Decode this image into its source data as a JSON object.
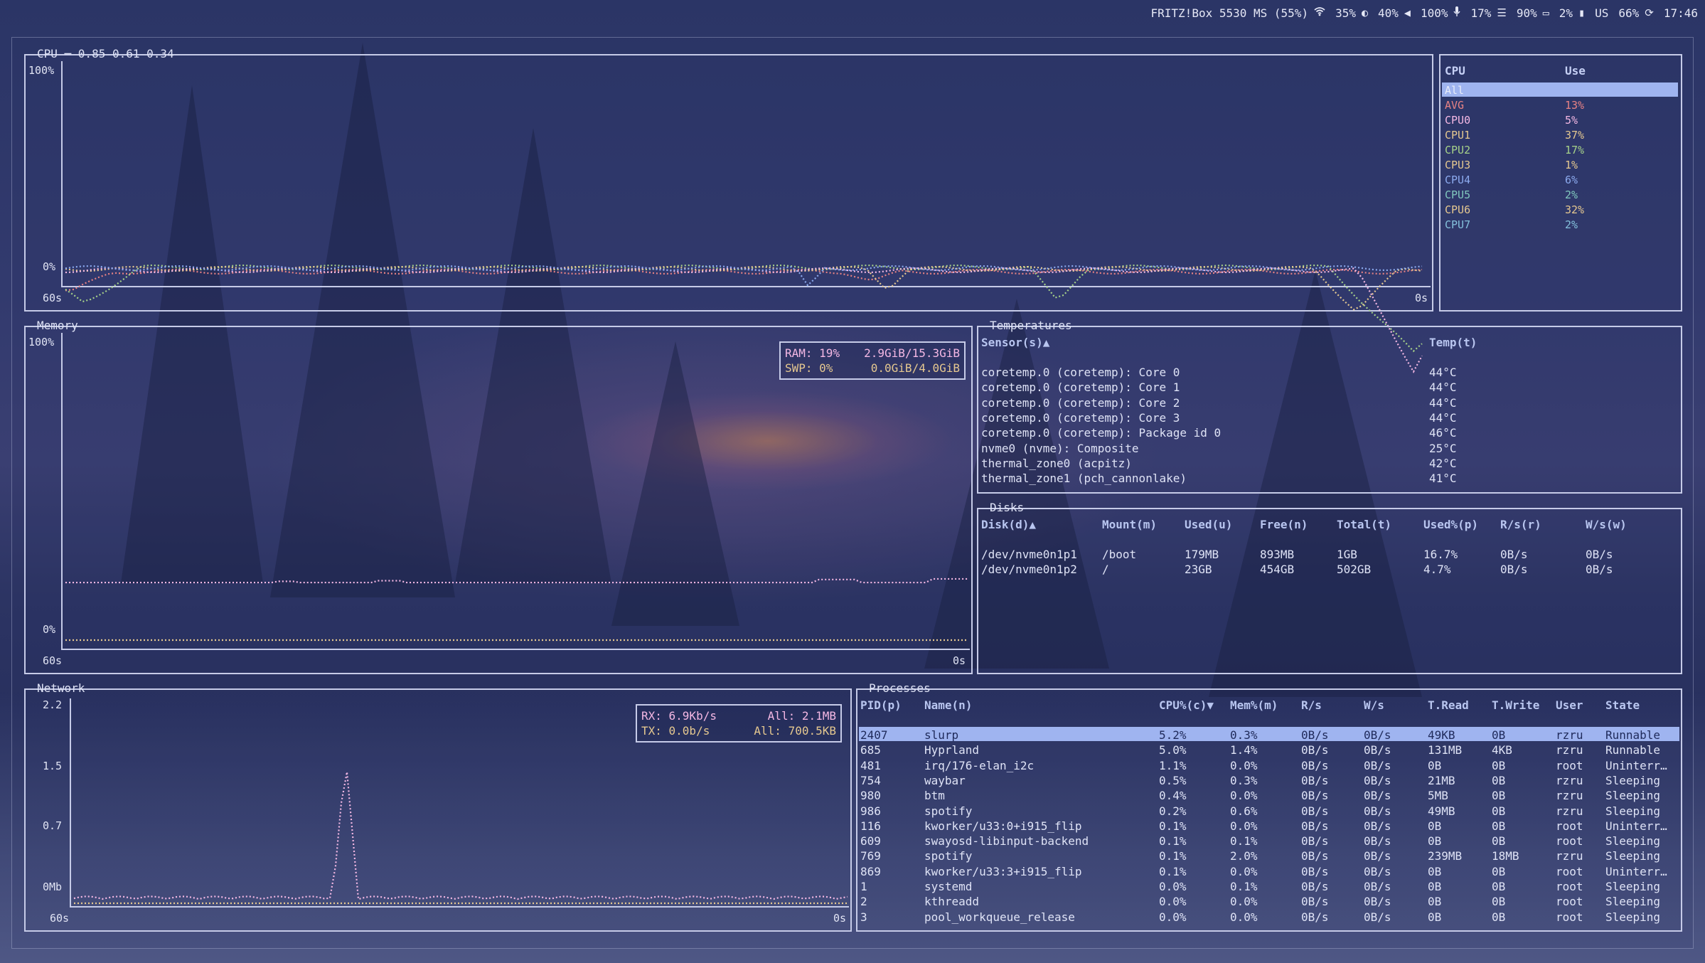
{
  "topbar": {
    "wifi": {
      "label": "FRITZ!Box 5530 MS (55%)",
      "icon": "wifi-icon"
    },
    "brightness": {
      "value": "35%",
      "icon": "brightness-icon"
    },
    "volume": {
      "value": "40%",
      "icon": "volume-icon"
    },
    "mic": {
      "value": "100%",
      "icon": "microphone-icon"
    },
    "cpu": {
      "value": "17%",
      "icon": "cpu-icon"
    },
    "memory": {
      "value": "90%",
      "icon": "memory-icon"
    },
    "disk": {
      "value": "2%",
      "icon": "disk-icon"
    },
    "layout": {
      "value": "US",
      "icon": "battery-icon"
    },
    "battery": {
      "value": "66%",
      "icon": "charging-icon"
    },
    "clock": "17:46"
  },
  "cpu": {
    "title": "CPU ─ 0.85 0.61 0.34",
    "y_max": "100%",
    "y_min": "0%",
    "x_left": "60s",
    "x_right": "0s",
    "list_header": {
      "cpu": "CPU",
      "use": "Use"
    },
    "rows": [
      {
        "name": "All",
        "use": "",
        "color": "#c6d0f5"
      },
      {
        "name": "AVG",
        "use": "13%",
        "color": "#e78284"
      },
      {
        "name": "CPU0",
        "use": "5%",
        "color": "#f4b8e4"
      },
      {
        "name": "CPU1",
        "use": "37%",
        "color": "#e5c890"
      },
      {
        "name": "CPU2",
        "use": "17%",
        "color": "#a6d189"
      },
      {
        "name": "CPU3",
        "use": "1%",
        "color": "#e5c890"
      },
      {
        "name": "CPU4",
        "use": "6%",
        "color": "#8caaee"
      },
      {
        "name": "CPU5",
        "use": "2%",
        "color": "#81c8be"
      },
      {
        "name": "CPU6",
        "use": "32%",
        "color": "#e5c890"
      },
      {
        "name": "CPU7",
        "use": "2%",
        "color": "#85c1dc"
      }
    ]
  },
  "memory": {
    "title": "Memory",
    "y_max": "100%",
    "y_min": "0%",
    "x_left": "60s",
    "x_right": "0s",
    "ram": {
      "label": "RAM:",
      "pct": "19%",
      "value": "2.9GiB/15.3GiB",
      "color": "#f4b8e4"
    },
    "swp": {
      "label": "SWP:",
      "pct": "0%",
      "value": "0.0GiB/4.0GiB",
      "color": "#e5c890"
    }
  },
  "temperatures": {
    "title": "Temperatures",
    "headers": [
      "Sensor(s)▲",
      "Temp(t)"
    ],
    "rows": [
      [
        "coretemp.0 (coretemp): Core 0",
        "44°C"
      ],
      [
        "coretemp.0 (coretemp): Core 1",
        "44°C"
      ],
      [
        "coretemp.0 (coretemp): Core 2",
        "44°C"
      ],
      [
        "coretemp.0 (coretemp): Core 3",
        "44°C"
      ],
      [
        "coretemp.0 (coretemp): Package id 0",
        "46°C"
      ],
      [
        "nvme0 (nvme): Composite",
        "25°C"
      ],
      [
        "thermal_zone0 (acpitz)",
        "42°C"
      ],
      [
        "thermal_zone1 (pch_cannonlake)",
        "41°C"
      ]
    ]
  },
  "disks": {
    "title": "Disks",
    "headers": [
      "Disk(d)▲",
      "Mount(m)",
      "Used(u)",
      "Free(n)",
      "Total(t)",
      "Used%(p)",
      "R/s(r)",
      "W/s(w)"
    ],
    "rows": [
      [
        "/dev/nvme0n1p1",
        "/boot",
        "179MB",
        "893MB",
        "1GB",
        "16.7%",
        "0B/s",
        "0B/s"
      ],
      [
        "/dev/nvme0n1p2",
        "/",
        "23GB",
        "454GB",
        "502GB",
        "4.7%",
        "0B/s",
        "0B/s"
      ]
    ]
  },
  "network": {
    "title": "Network",
    "y_ticks": [
      "2.2",
      "1.5",
      "0.7",
      "0Mb"
    ],
    "x_left": "60s",
    "x_right": "0s",
    "rx": {
      "label": "RX: 6.9Kb/s",
      "all": "All: 2.1MB",
      "color": "#f4b8e4"
    },
    "tx": {
      "label": "TX: 0.0b/s",
      "all": "All: 700.5KB",
      "color": "#e5c890"
    }
  },
  "processes": {
    "title": "Processes",
    "headers": [
      "PID(p)",
      "Name(n)",
      "CPU%(c)▼",
      "Mem%(m)",
      "R/s",
      "W/s",
      "T.Read",
      "T.Write",
      "User",
      "State"
    ],
    "rows": [
      [
        "2407",
        "slurp",
        "5.2%",
        "0.3%",
        "0B/s",
        "0B/s",
        "49KB",
        "0B",
        "rzru",
        "Runnable"
      ],
      [
        "685",
        "Hyprland",
        "5.0%",
        "1.4%",
        "0B/s",
        "0B/s",
        "131MB",
        "4KB",
        "rzru",
        "Runnable"
      ],
      [
        "481",
        "irq/176-elan_i2c",
        "1.1%",
        "0.0%",
        "0B/s",
        "0B/s",
        "0B",
        "0B",
        "root",
        "Uninterr…"
      ],
      [
        "754",
        "waybar",
        "0.5%",
        "0.3%",
        "0B/s",
        "0B/s",
        "21MB",
        "0B",
        "rzru",
        "Sleeping"
      ],
      [
        "980",
        "btm",
        "0.4%",
        "0.0%",
        "0B/s",
        "0B/s",
        "5MB",
        "0B",
        "rzru",
        "Sleeping"
      ],
      [
        "986",
        "spotify",
        "0.2%",
        "0.6%",
        "0B/s",
        "0B/s",
        "49MB",
        "0B",
        "rzru",
        "Sleeping"
      ],
      [
        "116",
        "kworker/u33:0+i915_flip",
        "0.1%",
        "0.0%",
        "0B/s",
        "0B/s",
        "0B",
        "0B",
        "root",
        "Uninterr…"
      ],
      [
        "609",
        "swayosd-libinput-backend",
        "0.1%",
        "0.1%",
        "0B/s",
        "0B/s",
        "0B",
        "0B",
        "root",
        "Sleeping"
      ],
      [
        "769",
        "spotify",
        "0.1%",
        "2.0%",
        "0B/s",
        "0B/s",
        "239MB",
        "18MB",
        "rzru",
        "Sleeping"
      ],
      [
        "869",
        "kworker/u33:3+i915_flip",
        "0.1%",
        "0.0%",
        "0B/s",
        "0B/s",
        "0B",
        "0B",
        "root",
        "Uninterr…"
      ],
      [
        "1",
        "systemd",
        "0.0%",
        "0.1%",
        "0B/s",
        "0B/s",
        "0B",
        "0B",
        "root",
        "Sleeping"
      ],
      [
        "2",
        "kthreadd",
        "0.0%",
        "0.0%",
        "0B/s",
        "0B/s",
        "0B",
        "0B",
        "root",
        "Sleeping"
      ],
      [
        "3",
        "pool_workqueue_release",
        "0.0%",
        "0.0%",
        "0B/s",
        "0B/s",
        "0B",
        "0B",
        "root",
        "Sleeping"
      ]
    ]
  },
  "colors": {
    "border": "#c6cbe8",
    "header": "#b9c6f0",
    "selected_row": "#9fb4f0",
    "ram": "#f4b8e4",
    "swap": "#e5c890"
  }
}
